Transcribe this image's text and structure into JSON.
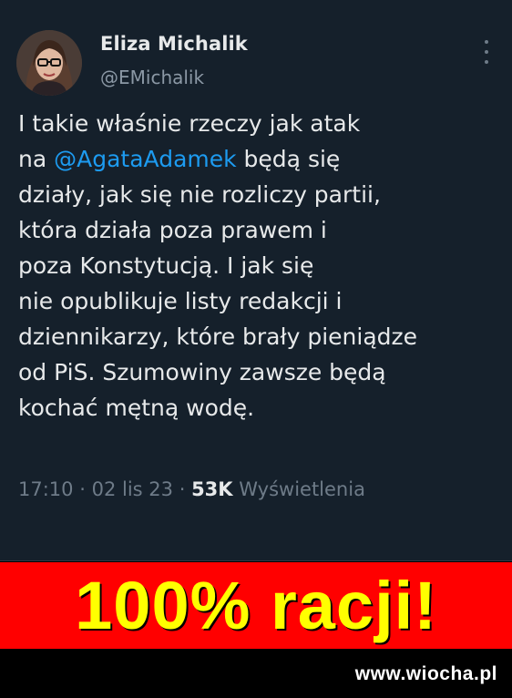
{
  "tweet": {
    "author_name": "Eliza Michalik",
    "author_handle": "@EMichalik",
    "text_lines": [
      {
        "before": "I takie właśnie rzeczy jak atak",
        "mention": "",
        "after": ""
      },
      {
        "before": "na ",
        "mention": "@AgataAdamek",
        "after": " będą się"
      },
      {
        "before": "działy, jak się nie rozliczy partii,",
        "mention": "",
        "after": ""
      },
      {
        "before": "która działa poza prawem i",
        "mention": "",
        "after": ""
      },
      {
        "before": "poza Konstytucją. I jak się",
        "mention": "",
        "after": ""
      },
      {
        "before": "nie opublikuje listy redakcji i",
        "mention": "",
        "after": ""
      },
      {
        "before": "dziennikarzy, które brały pieniądze",
        "mention": "",
        "after": ""
      },
      {
        "before": "od PiS. Szumowiny zawsze będą",
        "mention": "",
        "after": ""
      },
      {
        "before": "kochać mętną wodę.",
        "mention": "",
        "after": ""
      }
    ],
    "time": "17:10",
    "date": "02 lis 23",
    "views_count": "53K",
    "views_label": "Wyświetlenia",
    "separator": "·",
    "more_icon": "more-dots-icon"
  },
  "banner": {
    "text": "100% racji!"
  },
  "watermark": "www.wiocha.pl",
  "colors": {
    "tweet_bg": "#15202b",
    "text": "#e7e9ea",
    "secondary": "#8b98a5",
    "mention": "#1d9bf0",
    "banner_bg": "#ff0000",
    "banner_text": "#ffff00"
  }
}
